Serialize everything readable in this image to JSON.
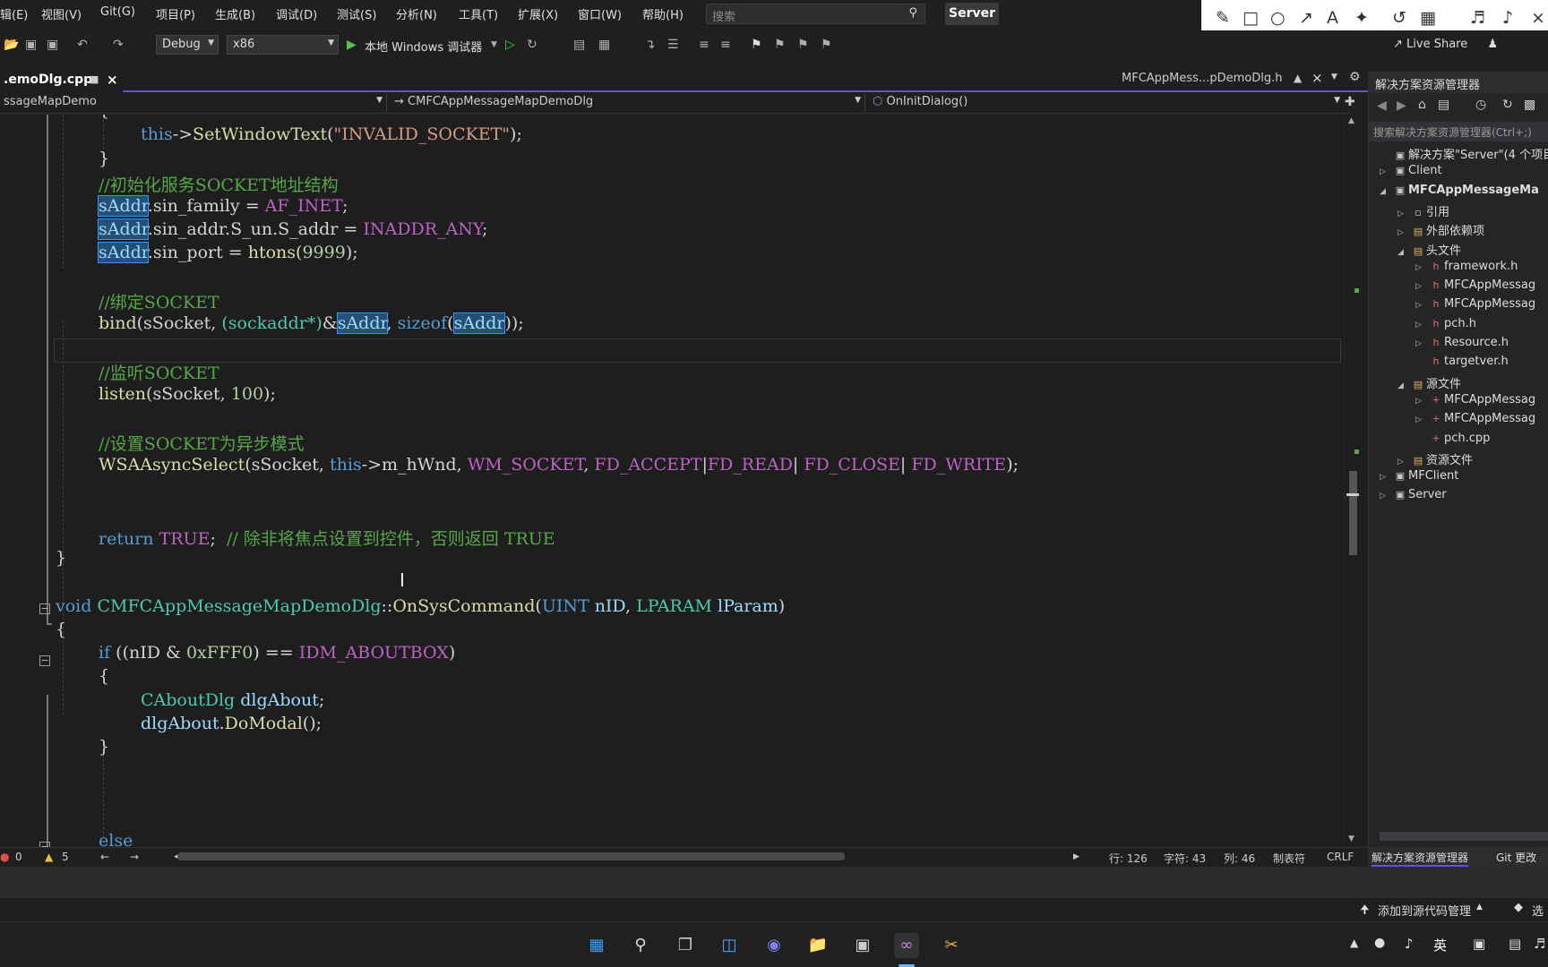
{
  "menu": [
    "辑(E)",
    "视图(V)",
    "Git(G)",
    "项目(P)",
    "生成(B)",
    "调试(D)",
    "测试(S)",
    "分析(N)",
    "工具(T)",
    "扩展(X)",
    "窗口(W)",
    "帮助(H)"
  ],
  "search_placeholder": "搜索",
  "solution_badge": "Server",
  "toolbar": {
    "config": "Debug",
    "platform": "x86",
    "run_label": "本地 Windows 调试器",
    "live_share": "Live Share"
  },
  "tabs": {
    "active": ".emoDlg.cpp",
    "right": "MFCAppMess...pDemoDlg.h"
  },
  "nav": {
    "project": "ssageMapDemo",
    "class": "→ CMFCAppMessageMapDemoDlg",
    "member": "OnInitDialog()"
  },
  "code": {
    "l1_this": "this",
    "l1_arrow": "->",
    "l1_fn": "SetWindowText",
    "l1_str": "\"INVALID_SOCKET\"",
    "l2_comment": "//初始化服务SOCKET地址结构",
    "saddr": "sAddr",
    "l3_rest": ".sin_family = ",
    "l3_mac": "AF_INET",
    "l4_rest": ".sin_addr.S_un.S_addr = ",
    "l4_mac": "INADDR_ANY",
    "l5_rest": ".sin_port = ",
    "l5_fn": "htons",
    "l5_num": "9999",
    "l6_comment": "//绑定SOCKET",
    "l7_bind": "bind",
    "l7_a": "(sSocket, ",
    "l7_cast": "(sockaddr*)",
    "l7_amp": "&",
    "l7_sizeof": "sizeof",
    "l7_end": "));",
    "l8_comment": "//监听SOCKET",
    "l9_listen": "listen",
    "l9_rest": "(sSocket, ",
    "l9_num": "100",
    "l10_comment": "//设置SOCKET为异步模式",
    "l11_fn": "WSAAsyncSelect",
    "l11_a": "(sSocket, ",
    "l11_this": "this",
    "l11_b": "->m_hWnd, ",
    "l11_m1": "WM_SOCKET",
    "l11_m2": "FD_ACCEPT",
    "l11_m3": "FD_READ",
    "l11_m4": "FD_CLOSE",
    "l11_m5": "FD_WRITE",
    "l12_ret": "return",
    "l12_true": "TRUE",
    "l12_comment": "// 除非将焦点设置到控件，否则返回 TRUE",
    "l13_void": "void",
    "l13_cls": "CMFCAppMessageMapDemoDlg",
    "l13_fn": "OnSysCommand",
    "l13_t1": "UINT",
    "l13_p1": "nID",
    "l13_t2": "LPARAM",
    "l13_p2": "lParam",
    "l14_if": "if",
    "l14_a": "((nID & ",
    "l14_num": "0xFFF0",
    "l14_b": ") == ",
    "l14_mac": "IDM_ABOUTBOX",
    "l15_type": "CAboutDlg",
    "l15_var": "dlgAbout",
    "l16_var": "dlgAbout",
    "l16_fn": "DoModal",
    "l17_else": "else"
  },
  "status": {
    "errors": "0",
    "warnings": "5",
    "line": "行: 126",
    "char": "字符: 43",
    "col": "列: 46",
    "tabs": "制表符",
    "eol": "CRLF"
  },
  "source_control": "添加到源代码管理",
  "source_control_right": "选",
  "solution_explorer": {
    "title": "解决方案资源管理器",
    "search": "搜索解决方案资源管理器(Ctrl+;)",
    "tree": [
      {
        "label": "解决方案\"Server\"(4 个项目",
        "level": 0,
        "twist": "",
        "icon": "▣",
        "bold": false
      },
      {
        "label": "Client",
        "level": 0,
        "twist": "▷",
        "icon": "▣",
        "bold": false
      },
      {
        "label": "MFCAppMessageMa",
        "level": 0,
        "twist": "◢",
        "icon": "▣",
        "bold": true
      },
      {
        "label": "引用",
        "level": 1,
        "twist": "▷",
        "icon": "▫",
        "bold": false
      },
      {
        "label": "外部依赖项",
        "level": 1,
        "twist": "▷",
        "icon": "▤",
        "bold": false
      },
      {
        "label": "头文件",
        "level": 1,
        "twist": "◢",
        "icon": "▤",
        "bold": false
      },
      {
        "label": "framework.h",
        "level": 2,
        "twist": "▷",
        "icon": "h",
        "bold": false
      },
      {
        "label": "MFCAppMessag",
        "level": 2,
        "twist": "▷",
        "icon": "h",
        "bold": false
      },
      {
        "label": "MFCAppMessag",
        "level": 2,
        "twist": "▷",
        "icon": "h",
        "bold": false
      },
      {
        "label": "pch.h",
        "level": 2,
        "twist": "▷",
        "icon": "h",
        "bold": false
      },
      {
        "label": "Resource.h",
        "level": 2,
        "twist": "▷",
        "icon": "h",
        "bold": false
      },
      {
        "label": "targetver.h",
        "level": 2,
        "twist": "",
        "icon": "h",
        "bold": false
      },
      {
        "label": "源文件",
        "level": 1,
        "twist": "◢",
        "icon": "▤",
        "bold": false
      },
      {
        "label": "MFCAppMessag",
        "level": 2,
        "twist": "▷",
        "icon": "+",
        "bold": false
      },
      {
        "label": "MFCAppMessag",
        "level": 2,
        "twist": "▷",
        "icon": "+",
        "bold": false
      },
      {
        "label": "pch.cpp",
        "level": 2,
        "twist": "",
        "icon": "+",
        "bold": false
      },
      {
        "label": "资源文件",
        "level": 1,
        "twist": "▷",
        "icon": "▤",
        "bold": false
      },
      {
        "label": "MFClient",
        "level": 0,
        "twist": "▷",
        "icon": "▣",
        "bold": false
      },
      {
        "label": "Server",
        "level": 0,
        "twist": "▷",
        "icon": "▣",
        "bold": false
      }
    ],
    "bottom_tabs": [
      "解决方案资源管理器",
      "Git 更改"
    ]
  },
  "tray": {
    "ime": "英"
  },
  "colors": {
    "accent": "#6c4ed8",
    "selection": "#264f78",
    "comment": "#57a64a",
    "keyword": "#569cd6",
    "macro": "#bd63c5",
    "string": "#d69d85",
    "function": "#dcdcaa",
    "type": "#4ec9b0"
  }
}
